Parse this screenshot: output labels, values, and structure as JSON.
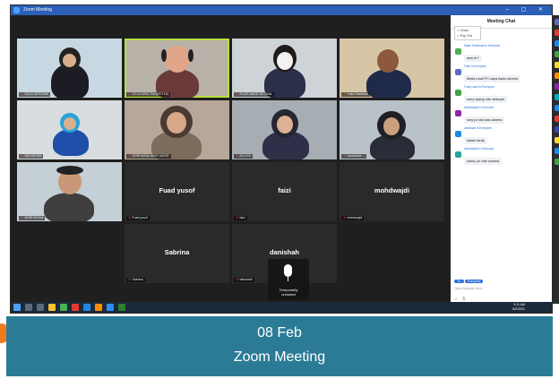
{
  "window": {
    "title": "Zoom Meeting"
  },
  "participants": [
    {
      "label": "SOLA SSTEONE",
      "kind": "video"
    },
    {
      "label": "VO GHONG PAN(PETSS)",
      "kind": "video"
    },
    {
      "label": "ELICE ANDS OS SHAL",
      "kind": "video"
    },
    {
      "label": "Fathi Shahbani",
      "kind": "video"
    },
    {
      "label": "NELVAFRIS",
      "kind": "video"
    },
    {
      "label": "NORHASNA BINTI NOOR",
      "kind": "video"
    },
    {
      "label": "AZLLFA",
      "kind": "video"
    },
    {
      "label": "Josephine ...",
      "kind": "video"
    },
    {
      "label": "NORHISYAM",
      "kind": "video"
    },
    {
      "name": "Fuad yusof",
      "label": "Fuad yusof",
      "kind": "name"
    },
    {
      "name": "faizi",
      "label": "faizi",
      "kind": "name"
    },
    {
      "name": "mohdwajdi",
      "label": "mohdwajdi",
      "kind": "name"
    },
    {
      "name": "Sabrina",
      "label": "Sabrina",
      "kind": "name"
    },
    {
      "name": "danishah",
      "label": "danishah",
      "kind": "name"
    }
  ],
  "mute_notice": {
    "line1": "Temporarily",
    "line2": "unmuted"
  },
  "chat": {
    "title": "Meeting Chat",
    "menu": [
      "Close",
      "Pop Out"
    ],
    "messages": [
      {
        "from": "Salim Shahbani to Everyone",
        "text": "sem tu?",
        "color": "#4caf50"
      },
      {
        "from": "Fatin to Everyone",
        "text": "Minta maaf PC saya tiada camera",
        "color": "#5c6bc0"
      },
      {
        "from": "Fuad yusof to Everyone",
        "text": "sorry laptop xde webcam",
        "color": "#43a047"
      },
      {
        "from": "Mohdwajdi to Everyone",
        "text": "sory pc tak ada camera",
        "color": "#8e24aa"
      },
      {
        "from": "danishah to Everyone",
        "text": "salam tarak",
        "color": "#1e88e5"
      },
      {
        "from": "mohdwajdi to Everyone",
        "text": "sama, pc xde camera",
        "color": "#26a69a"
      }
    ],
    "who_prefix": "To:",
    "who": "Everyone",
    "placeholder": "Type message here..."
  },
  "taskbar": {
    "time": "9:11 AM",
    "date": "8/2/2021"
  },
  "banner": {
    "date": "08 Feb",
    "title": "Zoom Meeting"
  }
}
